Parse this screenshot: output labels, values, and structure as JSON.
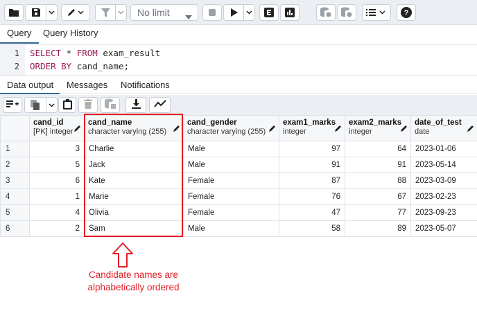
{
  "toolbar": {
    "limit_label": "No limit",
    "buttons": [
      {
        "icon": "folder-open-icon"
      },
      {
        "icon": "save-icon"
      },
      {
        "icon": "pencil-edit-icon"
      },
      {
        "icon": "filter-icon"
      },
      {
        "icon": "stop-icon"
      },
      {
        "icon": "play-execute-icon"
      },
      {
        "icon": "explain-icon"
      },
      {
        "icon": "explain-analyze-icon"
      },
      {
        "icon": "commit-icon"
      },
      {
        "icon": "rollback-icon"
      },
      {
        "icon": "macros-list-icon"
      },
      {
        "icon": "help-icon"
      }
    ]
  },
  "query_tabs": [
    {
      "label": "Query",
      "active": true
    },
    {
      "label": "Query History",
      "active": false
    }
  ],
  "editor": {
    "lines": [
      {
        "number": "1",
        "keyword1": "SELECT",
        "text1": " * ",
        "keyword2": "FROM",
        "text2": " exam_result"
      },
      {
        "number": "2",
        "keyword1": "ORDER BY",
        "text1": " cand_name;",
        "keyword2": "",
        "text2": ""
      }
    ]
  },
  "result_tabs": [
    {
      "label": "Data output",
      "active": true
    },
    {
      "label": "Messages",
      "active": false
    },
    {
      "label": "Notifications",
      "active": false
    }
  ],
  "grid": {
    "columns": [
      {
        "name": "cand_id",
        "type": "[PK] integer"
      },
      {
        "name": "cand_name",
        "type": "character varying (255)"
      },
      {
        "name": "cand_gender",
        "type": "character varying (255)"
      },
      {
        "name": "exam1_marks",
        "type": "integer"
      },
      {
        "name": "exam2_marks",
        "type": "integer"
      },
      {
        "name": "date_of_test",
        "type": "date"
      }
    ],
    "rows": [
      {
        "n": "1",
        "cells": [
          "3",
          "Charlie",
          "Male",
          "97",
          "64",
          "2023-01-06"
        ]
      },
      {
        "n": "2",
        "cells": [
          "5",
          "Jack",
          "Male",
          "91",
          "91",
          "2023-05-14"
        ]
      },
      {
        "n": "3",
        "cells": [
          "6",
          "Kate",
          "Female",
          "87",
          "88",
          "2023-03-09"
        ]
      },
      {
        "n": "4",
        "cells": [
          "1",
          "Marie",
          "Female",
          "76",
          "67",
          "2023-02-23"
        ]
      },
      {
        "n": "5",
        "cells": [
          "4",
          "Olivia",
          "Female",
          "47",
          "77",
          "2023-09-23"
        ]
      },
      {
        "n": "6",
        "cells": [
          "2",
          "Sam",
          "Male",
          "58",
          "89",
          "2023-05-07"
        ]
      }
    ]
  },
  "annotation": {
    "line1": "Candidate names are",
    "line2": "alphabetically ordered",
    "color": "#e31b23"
  },
  "colors": {
    "accent": "#326690",
    "keyword": "#9b1c5a",
    "toolbar_bg": "#ebeef3"
  }
}
